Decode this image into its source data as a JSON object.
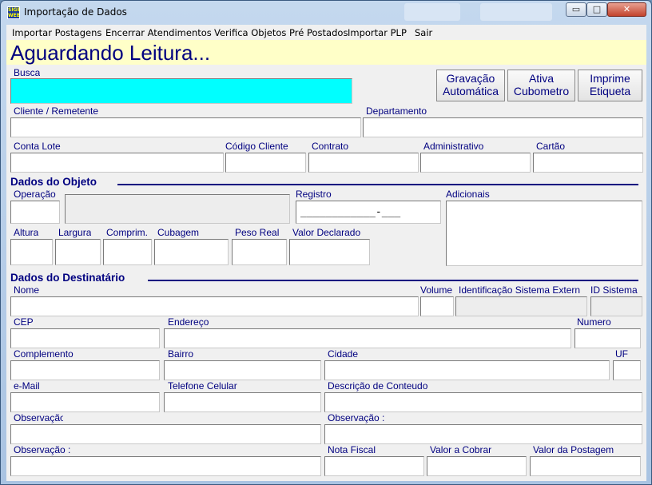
{
  "window": {
    "title": "Importação de Dados",
    "icon_text": "SIGEP WEB",
    "minimize": "▭",
    "maximize": "□",
    "close": "✕"
  },
  "menu": [
    {
      "label": "Importar Postagens"
    },
    {
      "label": "Encerrar Atendimentos"
    },
    {
      "label": "Verifica Objetos Pré Postados"
    },
    {
      "label": "Importar PLP"
    },
    {
      "label": "Sair"
    }
  ],
  "status": "Aguardando Leitura...",
  "busca": {
    "label": "Busca",
    "value": ""
  },
  "buttons": {
    "gravacao": [
      "Gravação",
      "Automática"
    ],
    "cubometro": [
      "Ativa",
      "Cubometro"
    ],
    "etiqueta": [
      "Imprime",
      "Etiqueta"
    ]
  },
  "cliente": {
    "remetente_label": "Cliente / Remetente",
    "departamento_label": "Departamento",
    "conta_lote_label": "Conta Lote",
    "codigo_cliente_label": "Código Cliente",
    "contrato_label": "Contrato",
    "administrativo_label": "Administrativo",
    "cartao_label": "Cartão"
  },
  "objeto": {
    "section": "Dados do Objeto",
    "operacao_label": "Operação",
    "registro_label": "Registro",
    "registro_mask": "____________-___",
    "adicionais_label": "Adicionais",
    "altura_label": "Altura",
    "largura_label": "Largura",
    "comprim_label": "Comprim.",
    "cubagem_label": "Cubagem",
    "peso_label": "Peso Real",
    "valor_declarado_label": "Valor Declarado"
  },
  "destinatario": {
    "section": "Dados do Destinatário",
    "nome_label": "Nome",
    "volume_label": "Volume",
    "ident_label": "Identificação Sistema Extern",
    "id_sistema_label": "ID Sistema",
    "cep_label": "CEP",
    "endereco_label": "Endereço",
    "numero_label": "Numero",
    "complemento_label": "Complemento",
    "bairro_label": "Bairro",
    "cidade_label": "Cidade",
    "uf_label": "UF",
    "email_label": "e-Mail",
    "telefone_label": "Telefone Celular",
    "descricao_label": "Descrição de Conteudo",
    "obs1_label": "Observação",
    "obs2_label": "Observação :",
    "obs3_label": "Observação :",
    "nota_fiscal_label": "Nota Fiscal",
    "valor_cobrar_label": "Valor a Cobrar",
    "valor_postagem_label": "Valor da Postagem"
  }
}
